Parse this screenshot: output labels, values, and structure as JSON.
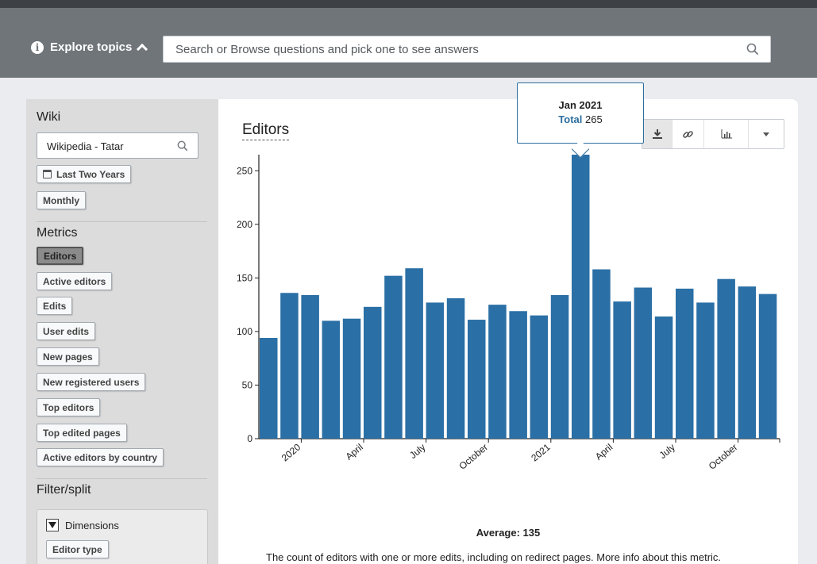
{
  "topbar": {
    "explore_label": "Explore topics",
    "search_placeholder": "Search or Browse questions and pick one to see answers"
  },
  "sidebar": {
    "wiki_label": "Wiki",
    "wiki_value": "Wikipedia - Tatar",
    "time_range": "Last Two Years",
    "granularity": "Monthly",
    "metrics_label": "Metrics",
    "metrics": [
      "Editors",
      "Active editors",
      "Edits",
      "User edits",
      "New pages",
      "New registered users",
      "Top editors",
      "Top edited pages",
      "Active editors by country"
    ],
    "selected_metric": "Editors",
    "filter_label": "Filter/split",
    "dimensions_label": "Dimensions",
    "dimension_button": "Editor type"
  },
  "main": {
    "title": "Editors",
    "toolbar": [
      "download-icon",
      "link-icon",
      "chart-type-icon",
      "dropdown-caret-icon"
    ],
    "tooltip": {
      "date": "Jan 2021",
      "key": "Total",
      "value": "265"
    },
    "average_label": "Average: 135",
    "description": "The count of editors with one or more edits, including on redirect pages.",
    "more_info": "More info about this metric."
  },
  "colors": {
    "bar": "#2a6fa5",
    "tooltip_border": "#2e6e9e",
    "topbar": "#70757a"
  },
  "chart_data": {
    "type": "bar",
    "title": "Editors",
    "x": [
      "2019-11",
      "2019-12",
      "2020-01",
      "2020-02",
      "2020-03",
      "2020-04",
      "2020-05",
      "2020-06",
      "2020-07",
      "2020-08",
      "2020-09",
      "2020-10",
      "2020-11",
      "2020-12",
      "2021-01",
      "2021-02",
      "2021-03",
      "2021-04",
      "2021-05",
      "2021-06",
      "2021-07",
      "2021-08",
      "2021-09",
      "2021-10",
      "2021-11"
    ],
    "values": [
      94,
      136,
      134,
      110,
      112,
      123,
      152,
      159,
      127,
      131,
      111,
      125,
      119,
      115,
      134,
      265,
      158,
      128,
      141,
      114,
      140,
      127,
      149,
      142,
      135
    ],
    "x_tick_labels": [
      {
        "label": "2020",
        "at": "2020-01"
      },
      {
        "label": "April",
        "at": "2020-04"
      },
      {
        "label": "July",
        "at": "2020-07"
      },
      {
        "label": "October",
        "at": "2020-10"
      },
      {
        "label": "2021",
        "at": "2021-01"
      },
      {
        "label": "April",
        "at": "2021-04"
      },
      {
        "label": "July",
        "at": "2021-07"
      },
      {
        "label": "October",
        "at": "2021-10"
      }
    ],
    "y_ticks": [
      0,
      50,
      100,
      150,
      200,
      250
    ],
    "ylim": [
      0,
      265
    ],
    "xlabel": "",
    "ylabel": "",
    "average": 135
  }
}
